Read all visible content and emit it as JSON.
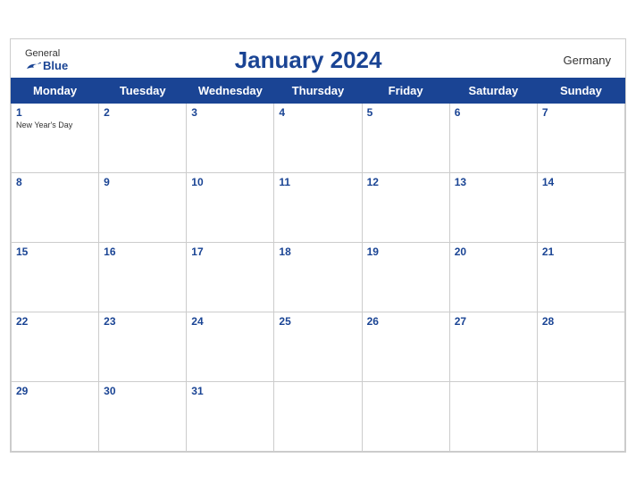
{
  "header": {
    "logo_general": "General",
    "logo_blue": "Blue",
    "title": "January 2024",
    "country": "Germany"
  },
  "weekdays": [
    "Monday",
    "Tuesday",
    "Wednesday",
    "Thursday",
    "Friday",
    "Saturday",
    "Sunday"
  ],
  "weeks": [
    [
      {
        "day": "1",
        "holiday": "New Year's Day"
      },
      {
        "day": "2",
        "holiday": ""
      },
      {
        "day": "3",
        "holiday": ""
      },
      {
        "day": "4",
        "holiday": ""
      },
      {
        "day": "5",
        "holiday": ""
      },
      {
        "day": "6",
        "holiday": ""
      },
      {
        "day": "7",
        "holiday": ""
      }
    ],
    [
      {
        "day": "8",
        "holiday": ""
      },
      {
        "day": "9",
        "holiday": ""
      },
      {
        "day": "10",
        "holiday": ""
      },
      {
        "day": "11",
        "holiday": ""
      },
      {
        "day": "12",
        "holiday": ""
      },
      {
        "day": "13",
        "holiday": ""
      },
      {
        "day": "14",
        "holiday": ""
      }
    ],
    [
      {
        "day": "15",
        "holiday": ""
      },
      {
        "day": "16",
        "holiday": ""
      },
      {
        "day": "17",
        "holiday": ""
      },
      {
        "day": "18",
        "holiday": ""
      },
      {
        "day": "19",
        "holiday": ""
      },
      {
        "day": "20",
        "holiday": ""
      },
      {
        "day": "21",
        "holiday": ""
      }
    ],
    [
      {
        "day": "22",
        "holiday": ""
      },
      {
        "day": "23",
        "holiday": ""
      },
      {
        "day": "24",
        "holiday": ""
      },
      {
        "day": "25",
        "holiday": ""
      },
      {
        "day": "26",
        "holiday": ""
      },
      {
        "day": "27",
        "holiday": ""
      },
      {
        "day": "28",
        "holiday": ""
      }
    ],
    [
      {
        "day": "29",
        "holiday": ""
      },
      {
        "day": "30",
        "holiday": ""
      },
      {
        "day": "31",
        "holiday": ""
      },
      {
        "day": "",
        "holiday": ""
      },
      {
        "day": "",
        "holiday": ""
      },
      {
        "day": "",
        "holiday": ""
      },
      {
        "day": "",
        "holiday": ""
      }
    ]
  ]
}
